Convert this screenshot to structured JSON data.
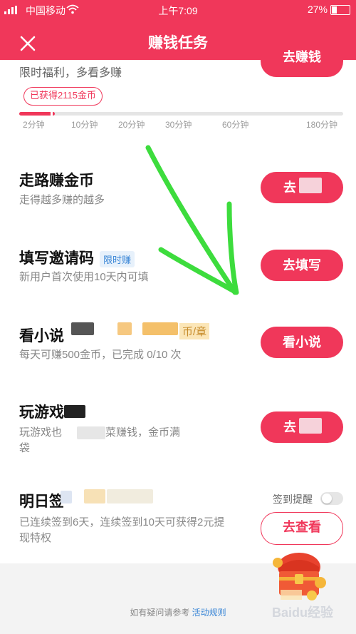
{
  "status_bar": {
    "carrier": "中国移动",
    "time": "上午7:09",
    "battery": "27%"
  },
  "nav": {
    "title": "赚钱任务"
  },
  "top_task": {
    "subtitle": "限时福利，多看多赚",
    "button": "去赚钱",
    "earned_label": "已获得2115金币",
    "progress_fraction": 0.11,
    "ticks": [
      "2分钟",
      "10分钟",
      "20分钟",
      "30分钟",
      "60分钟",
      "180分钟"
    ]
  },
  "tasks": [
    {
      "title": "走路赚金币",
      "desc": "走得越多赚的越多",
      "button": "去"
    },
    {
      "title": "填写邀请码",
      "tag": "限时赚",
      "desc": "新用户首次使用10天内可填",
      "button": "去填写"
    },
    {
      "title": "看小说",
      "reward": "币/章",
      "desc": "每天可赚500金币，已完成 0/10 次",
      "button": "看小说"
    },
    {
      "title": "玩游戏",
      "desc_line1": "玩游戏也",
      "desc_line1b": "菜赚钱，金币满",
      "desc_line2": "袋",
      "button": "去"
    },
    {
      "title": "明日签",
      "desc": "已连续签到6天，连续签到10天可获得2元提现特权",
      "toggle_label": "签到提醒",
      "button": "去查看"
    }
  ],
  "footer": {
    "text": "如有疑问请参考",
    "link": "活动规则"
  },
  "watermark": "Baidu经验",
  "colors": {
    "accent": "#f0375a",
    "link": "#3a86d6",
    "arrow": "#3ddc3d"
  }
}
